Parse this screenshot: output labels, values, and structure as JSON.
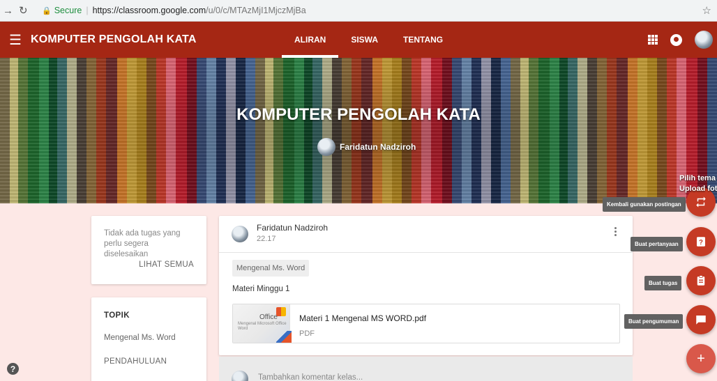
{
  "browser": {
    "secure_label": "Secure",
    "url_host": "https://classroom.google.com",
    "url_path": "/u/0/c/MTAzMjI1MjczMjBa"
  },
  "header": {
    "course_title": "KOMPUTER PENGOLAH KATA",
    "tabs": [
      {
        "label": "ALIRAN",
        "active": true
      },
      {
        "label": "SISWA",
        "active": false
      },
      {
        "label": "TENTANG",
        "active": false
      }
    ]
  },
  "banner": {
    "title": "KOMPUTER PENGOLAH KATA",
    "teacher": "Faridatun Nadziroh",
    "theme_link": "Pilih tema",
    "upload_link": "Upload foto"
  },
  "due_card": {
    "text": "Tidak ada tugas yang perlu segera diselesaikan",
    "link": "LIHAT SEMUA"
  },
  "topics": {
    "heading": "TOPIK",
    "items": [
      "Mengenal Ms. Word",
      "PENDAHULUAN"
    ]
  },
  "post": {
    "author": "Faridatun Nadziroh",
    "time": "22.17",
    "topic_chip": "Mengenal Ms. Word",
    "body": "Materi Minggu 1",
    "attachment": {
      "title": "Materi 1 Mengenal MS WORD.pdf",
      "type": "PDF",
      "thumb_brand": "Office",
      "thumb_caption": "Mengenal Microsoft Office Word"
    },
    "comment_placeholder": "Tambahkan komentar kelas..."
  },
  "fab": {
    "reuse_tip": "Kembali gunakan postingan",
    "question_tip": "Buat pertanyaan",
    "assignment_tip": "Buat tugas",
    "announcement_tip": "Buat pengumuman"
  },
  "colors": {
    "header": "#a52714",
    "fab": "#c53a24",
    "page_bg": "#fde8e6"
  }
}
